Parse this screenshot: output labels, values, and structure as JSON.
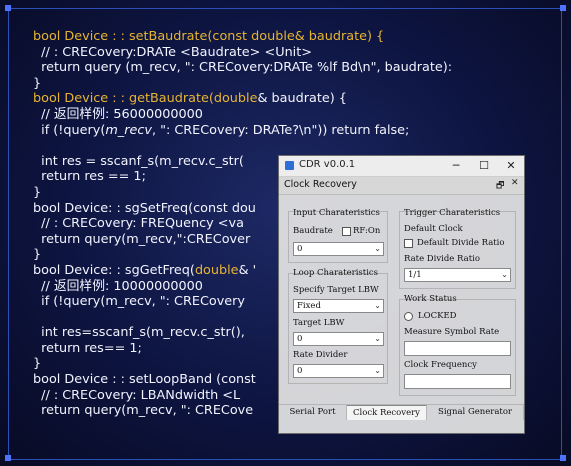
{
  "code_lines": [
    [
      {
        "t": "bool Device : : setBaudrate(",
        "c": "kw"
      },
      {
        "t": "const double",
        "c": "kw"
      },
      {
        "t": "& baudrate) {",
        "c": "kw"
      }
    ],
    [
      {
        "t": "  // : CRECovery:DRATe <Baudrate> <Unit>",
        "c": "pl"
      }
    ],
    [
      {
        "t": "  return query (m_recv, \": CRECovery:DRATe %lf Bd\\n\", baudrate):",
        "c": "pl"
      }
    ],
    [
      {
        "t": "}",
        "c": "pl"
      }
    ],
    [
      {
        "t": "bool Device : : getBaudrate(",
        "c": "kw"
      },
      {
        "t": "double",
        "c": "kw"
      },
      {
        "t": "& baudrate) {",
        "c": "pl"
      }
    ],
    [
      {
        "t": "  // 返回样例: 56000000000",
        "c": "pl"
      }
    ],
    [
      {
        "t": "  if (!query(",
        "c": "pl"
      },
      {
        "t": "m_recv",
        "c": "pl it"
      },
      {
        "t": ", \": CRECovery: DRATe?\\n\")) return false;",
        "c": "pl"
      }
    ],
    [
      {
        "t": "",
        "c": "pl"
      }
    ],
    [
      {
        "t": "  int res = sscanf_s(m_recv.c_str(",
        "c": "pl"
      }
    ],
    [
      {
        "t": "  return res == 1;",
        "c": "pl"
      }
    ],
    [
      {
        "t": "}",
        "c": "pl"
      }
    ],
    [
      {
        "t": "bool Device: : sgSetFreq(const dou",
        "c": "pl"
      }
    ],
    [
      {
        "t": "  // : CRECovery: FREQuency <va",
        "c": "pl"
      }
    ],
    [
      {
        "t": "  return query(m_recv,\":CRECover",
        "c": "pl"
      }
    ],
    [
      {
        "t": "}",
        "c": "pl"
      }
    ],
    [
      {
        "t": "bool Device: : sgGetFreq(",
        "c": "pl"
      },
      {
        "t": "double",
        "c": "kw"
      },
      {
        "t": "& '",
        "c": "pl"
      }
    ],
    [
      {
        "t": "  // 返回样例: 10000000000",
        "c": "pl"
      }
    ],
    [
      {
        "t": "  if (!query(m_recv, \": CRECovery",
        "c": "pl"
      }
    ],
    [
      {
        "t": "",
        "c": "pl"
      }
    ],
    [
      {
        "t": "  int res=sscanf_s(m_recv.c_str(),",
        "c": "pl"
      }
    ],
    [
      {
        "t": "  return res== 1;",
        "c": "pl"
      }
    ],
    [
      {
        "t": "}",
        "c": "pl"
      }
    ],
    [
      {
        "t": "bool Device : : setLoopBand (const",
        "c": "pl"
      }
    ],
    [
      {
        "t": "  // : CRECovery: LBANdwidth <L",
        "c": "pl"
      }
    ],
    [
      {
        "t": "  return query(m_recv, \": CRECove",
        "c": "pl"
      }
    ]
  ],
  "window": {
    "title": "CDR v0.0.1",
    "minimize": "─",
    "maximize": "☐",
    "close": "✕",
    "panel_title": "Clock Recovery",
    "panel_float": "🗗",
    "panel_close": "✕",
    "input": {
      "group_title": "Input Charateristics",
      "baudrate_label": "Baudrate",
      "rf_on_label": "RF:On",
      "baudrate_value": "0"
    },
    "loop": {
      "group_title": "Loop Charateristics",
      "specify_label": "Specify Target LBW",
      "specify_value": "Fixed",
      "target_label": "Target LBW",
      "target_value": "0",
      "rate_divider_label": "Rate Divider",
      "rate_divider_value": "0"
    },
    "trigger": {
      "group_title": "Trigger Charateristics",
      "default_clock_label": "Default Clock",
      "default_divide_label": "Default Divide Ratio",
      "rate_divide_label": "Rate Divide Ratio",
      "rate_divide_value": "1/1"
    },
    "work": {
      "group_title": "Work Status",
      "locked_label": "LOCKED",
      "measure_label": "Measure Symbol Rate",
      "clock_freq_label": "Clock Frequency"
    },
    "tabs": [
      "Serial Port",
      "Clock Recovery",
      "Signal Generator"
    ]
  },
  "colors": {
    "keyword": "#e7b431",
    "accent_frame": "#2b4fb6"
  }
}
